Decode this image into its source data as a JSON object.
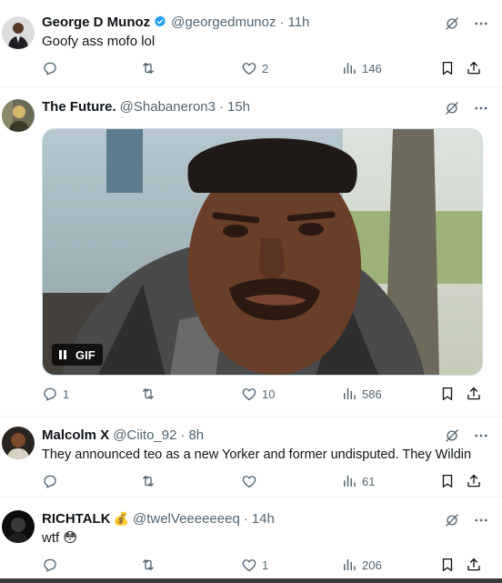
{
  "tweets": [
    {
      "name": "George D Munoz",
      "verified": true,
      "handle": "@georgedmunoz",
      "time": "11h",
      "text": "Goofy ass mofo lol",
      "replies": "",
      "retweets": "",
      "likes": "2",
      "views": "146"
    },
    {
      "name": "The Future.",
      "verified": false,
      "handle": "@Shabaneron3",
      "time": "15h",
      "text": "",
      "media_label": "GIF",
      "replies": "1",
      "retweets": "",
      "likes": "10",
      "views": "586"
    },
    {
      "name": "Malcolm X",
      "verified": false,
      "handle": "@Ciito_92",
      "time": "8h",
      "text": "They announced teo as a new Yorker and former undisputed. They Wildin",
      "replies": "",
      "retweets": "",
      "likes": "",
      "views": "61"
    },
    {
      "name": "RICHTALK",
      "name_emoji": "💰",
      "verified": false,
      "handle": "@twelVeeeeeeeq",
      "time": "14h",
      "text": "wtf 😳",
      "replies": "",
      "retweets": "",
      "likes": "1",
      "views": "206"
    }
  ],
  "icons": {
    "reply": "reply-icon",
    "retweet": "retweet-icon",
    "like": "heart-icon",
    "views": "views-icon",
    "bookmark": "bookmark-icon",
    "share": "share-icon",
    "grok": "grok-icon",
    "more": "more-icon",
    "verified": "verified-badge-icon"
  },
  "colors": {
    "text": "#0f1419",
    "secondary": "#536471",
    "verified": "#1d9bf0",
    "divider": "#eff3f4"
  }
}
